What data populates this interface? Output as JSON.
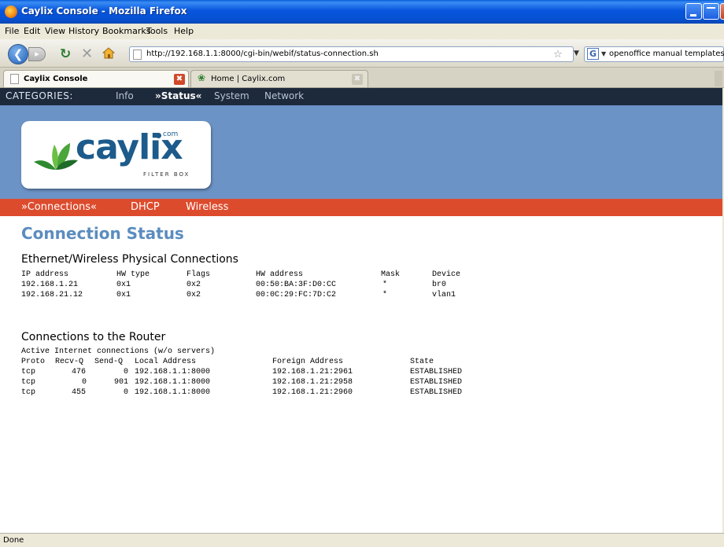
{
  "window": {
    "title": "Caylix Console - Mozilla Firefox"
  },
  "menu": [
    "File",
    "Edit",
    "View",
    "History",
    "Bookmarks",
    "Tools",
    "Help"
  ],
  "toolbar": {
    "url": "http://192.168.1.1:8000/cgi-bin/webif/status-connection.sh",
    "search_query": "openoffice manual templates",
    "search_engine_icon": "G"
  },
  "tabs": [
    {
      "label": "Caylix Console",
      "active": true
    },
    {
      "label": "Home | Caylix.com",
      "active": false
    }
  ],
  "categories": {
    "label": "CATEGORIES:",
    "items": [
      "Info",
      "»Status«",
      "System",
      "Network"
    ],
    "active_index": 1
  },
  "logo": {
    "text": "caylix",
    "com": "com",
    "sub": "FILTER BOX"
  },
  "subnav": {
    "items": [
      "»Connections«",
      "DHCP",
      "Wireless"
    ],
    "active_index": 0
  },
  "page_title": "Connection Status",
  "physical": {
    "heading": "Ethernet/Wireless Physical Connections",
    "columns": [
      "IP address",
      "HW type",
      "Flags",
      "HW address",
      "Mask",
      "Device"
    ],
    "rows": [
      [
        "192.168.1.21",
        "0x1",
        "0x2",
        "00:50:BA:3F:D0:CC",
        "*",
        "br0"
      ],
      [
        "192.168.21.12",
        "0x1",
        "0x2",
        "00:0C:29:FC:7D:C2",
        "*",
        "vlan1"
      ]
    ]
  },
  "router": {
    "heading": "Connections to the Router",
    "caption": "Active Internet connections (w/o servers)",
    "columns": [
      "Proto",
      "Recv-Q",
      "Send-Q",
      "Local Address",
      "Foreign Address",
      "State"
    ],
    "rows": [
      [
        "tcp",
        "476",
        "0",
        "192.168.1.1:8000",
        "192.168.1.21:2961",
        "ESTABLISHED"
      ],
      [
        "tcp",
        "0",
        "901",
        "192.168.1.1:8000",
        "192.168.1.21:2958",
        "ESTABLISHED"
      ],
      [
        "tcp",
        "455",
        "0",
        "192.168.1.1:8000",
        "192.168.1.21:2960",
        "ESTABLISHED"
      ]
    ]
  },
  "status": "Done"
}
